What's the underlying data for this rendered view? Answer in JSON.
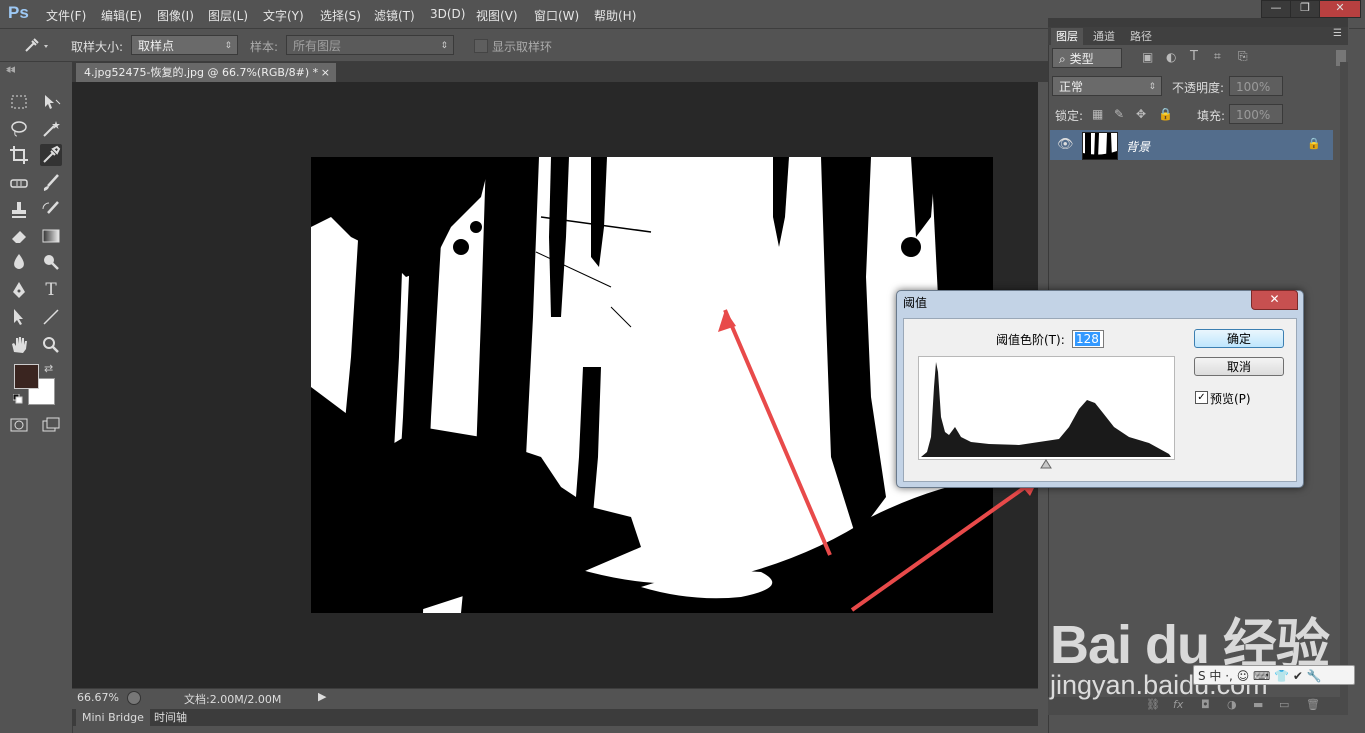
{
  "app": {
    "logo": "Ps",
    "menu": [
      "文件(F)",
      "编辑(E)",
      "图像(I)",
      "图层(L)",
      "文字(Y)",
      "选择(S)",
      "滤镜(T)",
      "3D(D)",
      "视图(V)",
      "窗口(W)",
      "帮助(H)"
    ],
    "window_buttons": [
      "—",
      "❐",
      "✕"
    ]
  },
  "options_bar": {
    "sample_size_label": "取样大小:",
    "sample_size_value": "取样点",
    "sample_label": "样本:",
    "sample_value": "所有图层",
    "show_ring_label": "显示取样环"
  },
  "document": {
    "tab_title": "4.jpg52475-恢复的.jpg @ 66.7%(RGB/8#) *",
    "tab_close": "×"
  },
  "status": {
    "zoom": "66.67%",
    "doc_info": "文档:2.00M/2.00M"
  },
  "bottom_tabs": [
    "Mini Bridge",
    "时间轴"
  ],
  "colors": {
    "foreground": "#3a2520",
    "background": "#ffffff",
    "selected_layer": "#536d8c"
  },
  "layers_panel": {
    "tabs": [
      "图层",
      "通道",
      "路径"
    ],
    "filter_kind": "类型",
    "blend_mode": "正常",
    "opacity_label": "不透明度:",
    "opacity_value": "100%",
    "lock_label": "锁定:",
    "fill_label": "填充:",
    "fill_value": "100%",
    "layer_name": "背景",
    "footer_icons": [
      "link-icon",
      "fx-icon",
      "mask-icon",
      "adjustment-icon",
      "folder-icon",
      "new-layer-icon",
      "trash-icon"
    ]
  },
  "threshold_dialog": {
    "title": "阈值",
    "level_label": "阈值色阶(T):",
    "level_value": "128",
    "ok_label": "确定",
    "cancel_label": "取消",
    "preview_label": "预览(P)",
    "preview_checked": true,
    "close_symbol": "✕"
  },
  "watermark": {
    "brand": "Bai du 经验",
    "url": "jingyan.baidu.com"
  },
  "ime_bar": {
    "text": "S 中 ·, ☺ ⌨ 👕 ✔ 🔧"
  }
}
